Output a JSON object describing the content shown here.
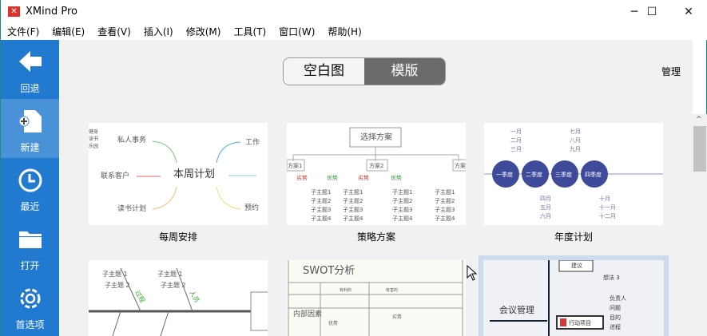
{
  "window": {
    "title": "XMind Pro",
    "minimize": "─",
    "maximize": "☐",
    "close": "✕"
  },
  "menu": [
    "文件(F)",
    "编辑(E)",
    "查看(V)",
    "插入(I)",
    "修改(M)",
    "工具(T)",
    "窗口(W)",
    "帮助(H)"
  ],
  "sidebar": {
    "items": [
      {
        "label": "回退",
        "icon": "back-arrow-icon"
      },
      {
        "label": "新建",
        "icon": "new-file-icon",
        "active": true
      },
      {
        "label": "最近",
        "icon": "clock-icon"
      },
      {
        "label": "打开",
        "icon": "folder-icon"
      },
      {
        "label": "首选项",
        "icon": "gear-icon"
      }
    ],
    "color": "#2179d0"
  },
  "toggle": {
    "blank": "空白图",
    "template": "模版",
    "selected": "模版"
  },
  "manage": "管理",
  "templates": [
    {
      "name": "每周安排",
      "center": "本周计划",
      "topics": [
        "私人事务",
        "工作",
        "联系客户",
        "读书计划",
        "预约",
        "健身",
        "读书",
        "乐园"
      ]
    },
    {
      "name": "策略方案",
      "center": "选择方案",
      "topics": [
        "方案1",
        "方案2",
        "方案",
        "劣势",
        "优势",
        "子主题1",
        "子主题2",
        "子主题3",
        "子主题4"
      ]
    },
    {
      "name": "年度计划",
      "topics": [
        "一季度",
        "二季度",
        "三季度",
        "四季度",
        "一月",
        "二月",
        "三月",
        "七月",
        "八月",
        "九月",
        "四月",
        "五月",
        "六月",
        "十月",
        "十一月",
        "十二月"
      ]
    },
    {
      "name": "",
      "topics": [
        "子主题 1",
        "子主题 2",
        "过程",
        "人员"
      ]
    },
    {
      "name": "",
      "center": "SWOT分析",
      "topics": [
        "内部因素",
        "有利的",
        "有害的",
        "优势",
        "劣势"
      ]
    },
    {
      "name": "",
      "center": "会议管理",
      "topics": [
        "建议",
        "想法 3",
        "行动项目",
        "负责人",
        "问题",
        "目的",
        "进程"
      ],
      "selected": true
    }
  ]
}
